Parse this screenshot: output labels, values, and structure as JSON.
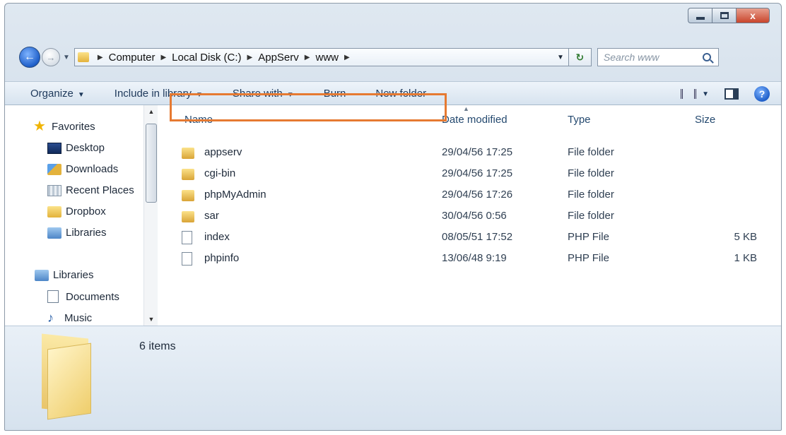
{
  "window": {
    "minimize_icon": "minimize-icon",
    "maximize_icon": "maximize-icon",
    "close_glyph": "x"
  },
  "nav": {
    "back_glyph": "←",
    "forward_glyph": "→",
    "breadcrumbs": [
      "Computer",
      "Local Disk (C:)",
      "AppServ",
      "www"
    ],
    "refresh_glyph": "↻",
    "search_placeholder": "Search www"
  },
  "toolbar": {
    "organize": "Organize",
    "include_in_library": "Include in library",
    "share_with": "Share with",
    "burn": "Burn",
    "new_folder": "New folder",
    "help_glyph": "?"
  },
  "sidebar": {
    "items": [
      {
        "label": "Favorites",
        "icon": "star-icon"
      },
      {
        "label": "Desktop",
        "icon": "desktop-icon"
      },
      {
        "label": "Downloads",
        "icon": "downloads-folder-icon"
      },
      {
        "label": "Recent Places",
        "icon": "recent-places-icon"
      },
      {
        "label": "Dropbox",
        "icon": "folder-icon"
      },
      {
        "label": "Libraries",
        "icon": "libraries-icon"
      },
      {
        "label": "Libraries",
        "icon": "libraries-icon"
      },
      {
        "label": "Documents",
        "icon": "document-icon"
      },
      {
        "label": "Music",
        "icon": "music-icon"
      }
    ]
  },
  "columns": {
    "name": "Name",
    "date_modified": "Date modified",
    "type": "Type",
    "size": "Size"
  },
  "files": [
    {
      "name": "appserv",
      "date": "29/04/56 17:25",
      "type": "File folder",
      "size": "",
      "kind": "folder"
    },
    {
      "name": "cgi-bin",
      "date": "29/04/56 17:25",
      "type": "File folder",
      "size": "",
      "kind": "folder"
    },
    {
      "name": "phpMyAdmin",
      "date": "29/04/56 17:26",
      "type": "File folder",
      "size": "",
      "kind": "folder"
    },
    {
      "name": "sar",
      "date": "30/04/56 0:56",
      "type": "File folder",
      "size": "",
      "kind": "folder"
    },
    {
      "name": "index",
      "date": "08/05/51 17:52",
      "type": "PHP File",
      "size": "5 KB",
      "kind": "file"
    },
    {
      "name": "phpinfo",
      "date": "13/06/48 9:19",
      "type": "PHP File",
      "size": "1 KB",
      "kind": "file"
    }
  ],
  "status": {
    "item_count": "6 items"
  },
  "colors": {
    "highlight": "#e67a32",
    "command_text": "#1e395b"
  }
}
